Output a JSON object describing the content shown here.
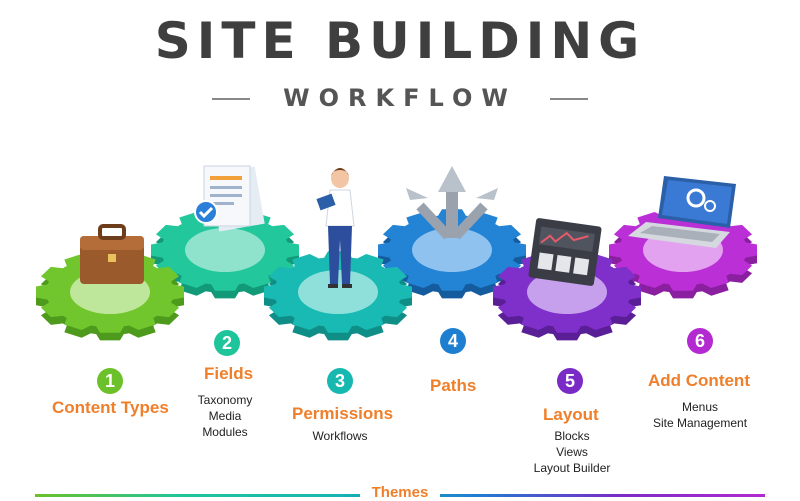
{
  "header": {
    "title": "SITE BUILDING",
    "subtitle": "WORKFLOW"
  },
  "steps": [
    {
      "number": "1",
      "title": "Content Types",
      "items": [],
      "color": "#6cc02a",
      "icon": "briefcase-icon"
    },
    {
      "number": "2",
      "title": "Fields",
      "items": [
        "Taxonomy",
        "Media",
        "Modules"
      ],
      "color": "#1fc59a",
      "icon": "documents-icon"
    },
    {
      "number": "3",
      "title": "Permissions",
      "items": [
        "Workflows"
      ],
      "color": "#17b8b0",
      "icon": "person-icon"
    },
    {
      "number": "4",
      "title": "Paths",
      "items": [],
      "color": "#1e7fd0",
      "icon": "arrows-icon"
    },
    {
      "number": "5",
      "title": "Layout",
      "items": [
        "Blocks",
        "Views",
        "Layout Builder"
      ],
      "color": "#7a2bc6",
      "icon": "dashboard-icon"
    },
    {
      "number": "6",
      "title": "Add Content",
      "items": [
        "Menus",
        "Site Management"
      ],
      "color": "#b32ad0",
      "icon": "laptop-icon"
    }
  ],
  "footer": {
    "label": "Themes"
  },
  "colors": {
    "accent": "#ef7f2a",
    "title": "#3f3f3f"
  }
}
